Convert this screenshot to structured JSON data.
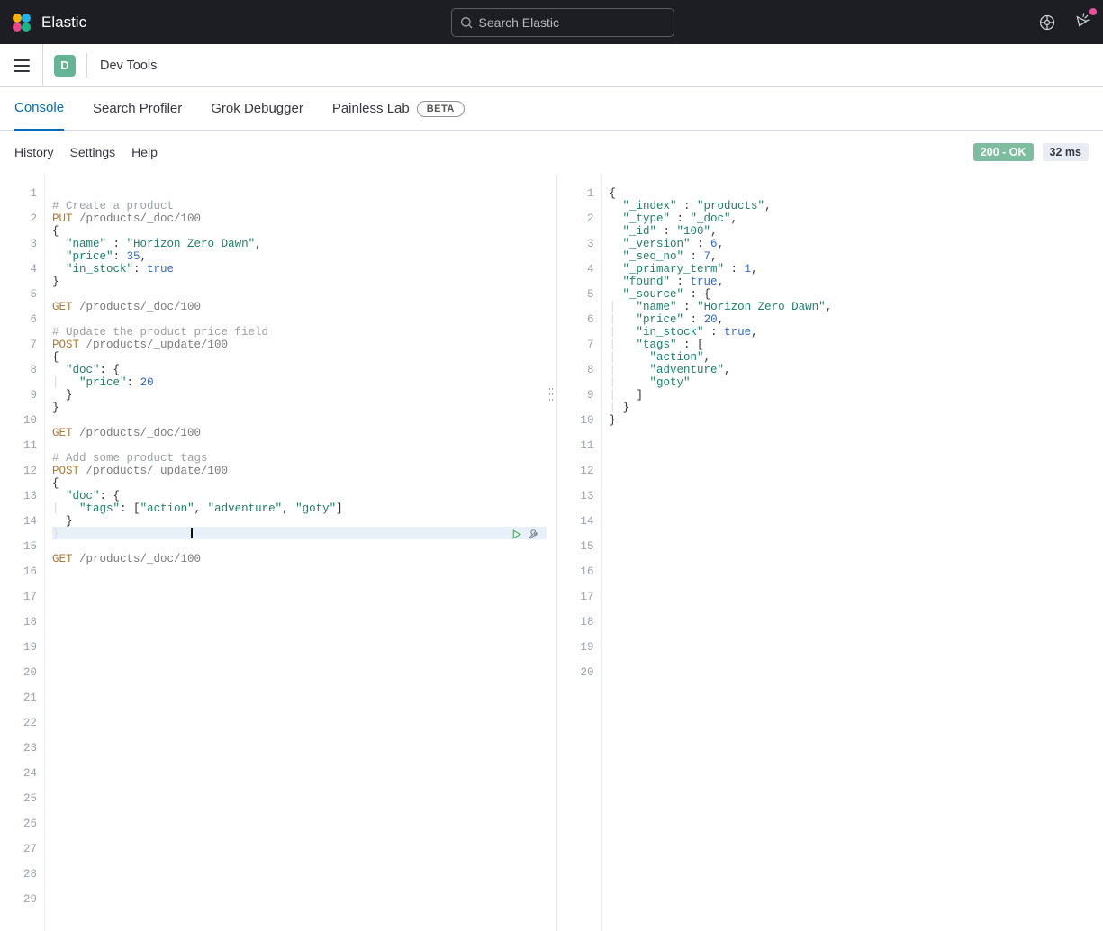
{
  "header": {
    "brand": "Elastic",
    "search_placeholder": "Search Elastic"
  },
  "breadcrumb": {
    "space_letter": "D",
    "page": "Dev Tools"
  },
  "tabs": {
    "console": "Console",
    "search_profiler": "Search Profiler",
    "grok_debugger": "Grok Debugger",
    "painless_lab": "Painless Lab",
    "beta_label": "BETA"
  },
  "toolbar": {
    "history": "History",
    "settings": "Settings",
    "help": "Help",
    "status": "200 - OK",
    "time": "32 ms"
  },
  "request": {
    "lines": [
      "1",
      "2",
      "3",
      "4",
      "5",
      "6",
      "7",
      "8",
      "9",
      "10",
      "11",
      "12",
      "13",
      "14",
      "15",
      "16",
      "17",
      "18",
      "19",
      "20",
      "21",
      "22",
      "23",
      "24",
      "25",
      "26",
      "27",
      "28",
      "29"
    ],
    "comment_create": "# Create a product",
    "put": "PUT",
    "path_doc": "/products/_doc/100",
    "k_name": "\"name\"",
    "v_name": "\"Horizon Zero Dawn\"",
    "k_price": "\"price\"",
    "v_price_35": "35",
    "k_in_stock": "\"in_stock\"",
    "v_true": "true",
    "get": "GET",
    "comment_update_price": "# Update the product price field",
    "post": "POST",
    "path_update": "/products/_update/100",
    "k_doc": "\"doc\"",
    "v_price_20": "20",
    "comment_tags": "# Add some product tags",
    "k_tags": "\"tags\"",
    "v_tag_action": "\"action\"",
    "v_tag_adventure": "\"adventure\"",
    "v_tag_goty": "\"goty\""
  },
  "response": {
    "lines": [
      "1",
      "2",
      "3",
      "4",
      "5",
      "6",
      "7",
      "8",
      "9",
      "10",
      "11",
      "12",
      "13",
      "14",
      "15",
      "16",
      "17",
      "18",
      "19",
      "20"
    ],
    "k_index": "\"_index\"",
    "v_index": "\"products\"",
    "k_type": "\"_type\"",
    "v_type": "\"_doc\"",
    "k_id": "\"_id\"",
    "v_id": "\"100\"",
    "k_version": "\"_version\"",
    "v_version": "6",
    "k_seq_no": "\"_seq_no\"",
    "v_seq_no": "7",
    "k_primary_term": "\"_primary_term\"",
    "v_primary_term": "1",
    "k_found": "\"found\"",
    "v_found": "true",
    "k_source": "\"_source\"",
    "k_name": "\"name\"",
    "v_name": "\"Horizon Zero Dawn\"",
    "k_price": "\"price\"",
    "v_price": "20",
    "k_in_stock": "\"in_stock\"",
    "v_in_stock": "true",
    "k_tags": "\"tags\"",
    "v_tag_action": "\"action\"",
    "v_tag_adventure": "\"adventure\"",
    "v_tag_goty": "\"goty\""
  }
}
